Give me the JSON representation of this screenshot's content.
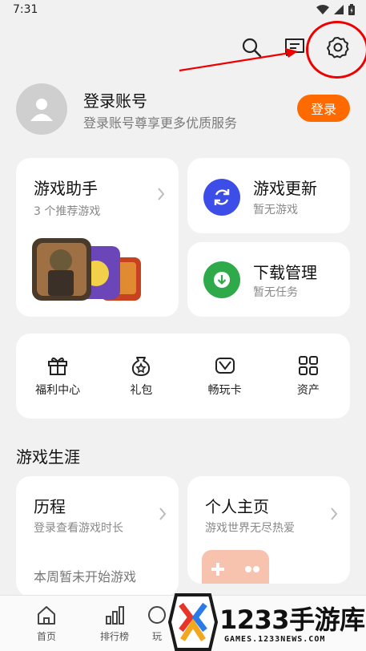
{
  "status_bar": {
    "time": "7:31"
  },
  "top_actions": {
    "icons": [
      "search-icon",
      "message-icon",
      "settings-icon"
    ]
  },
  "account": {
    "title": "登录账号",
    "subtitle": "登录账号尊享更多优质服务",
    "login_button": "登录"
  },
  "assistant_card": {
    "title": "游戏助手",
    "subtitle": "3 个推荐游戏"
  },
  "update_card": {
    "title": "游戏更新",
    "subtitle": "暂无游戏",
    "icon_color": "#3d4ee8"
  },
  "download_card": {
    "title": "下载管理",
    "subtitle": "暂无任务",
    "icon_color": "#2eaa4a"
  },
  "quick_actions": [
    {
      "label": "福利中心",
      "icon": "gift-icon"
    },
    {
      "label": "礼包",
      "icon": "gift-bag-icon"
    },
    {
      "label": "畅玩卡",
      "icon": "card-icon"
    },
    {
      "label": "资产",
      "icon": "grid-icon"
    }
  ],
  "career": {
    "section_title": "游戏生涯",
    "history": {
      "title": "历程",
      "subtitle": "登录查看游戏时长",
      "note": "本周暂未开始游戏"
    },
    "homepage": {
      "title": "个人主页",
      "subtitle": "游戏世界无尽热爱"
    }
  },
  "bottom_nav": [
    {
      "label": "首页",
      "icon": "home-icon"
    },
    {
      "label": "排行榜",
      "icon": "rank-icon"
    },
    {
      "label": "玩",
      "icon": "play-icon"
    }
  ],
  "watermark": {
    "brand": "1233手游库",
    "domain": "GAMES.1233NEWS.COM"
  },
  "colors": {
    "accent": "#ff6a00",
    "annotation": "#e00000",
    "background": "#f1f1f1"
  }
}
